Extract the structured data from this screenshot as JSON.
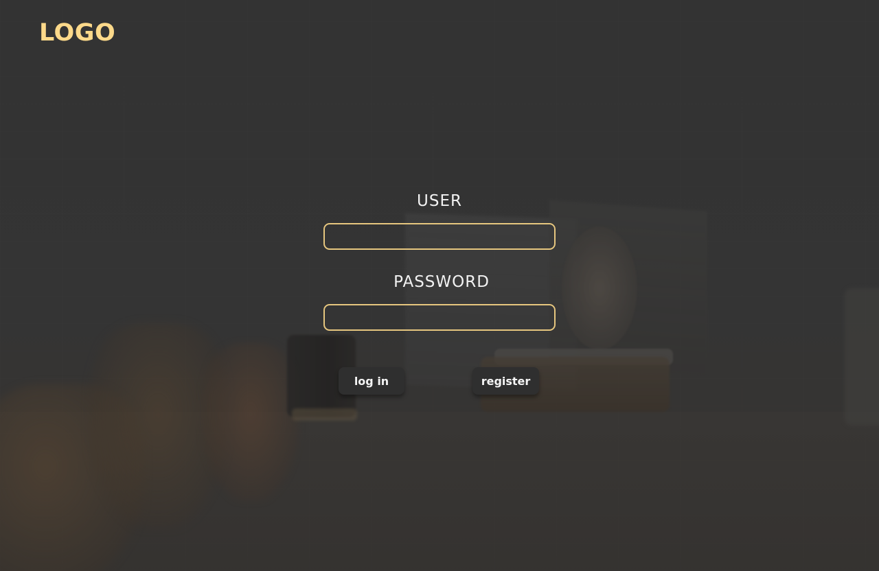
{
  "header": {
    "logo_text": "LOGO"
  },
  "login_form": {
    "user_label": "USER",
    "user_value": "",
    "password_label": "PASSWORD",
    "password_value": ""
  },
  "actions": {
    "login_label": "log in",
    "register_label": "register"
  },
  "colors": {
    "accent": "#fcd98a",
    "input_border": "#e7c77f",
    "button_bg": "#2f2f2f",
    "overlay": "#3a3a3a"
  }
}
